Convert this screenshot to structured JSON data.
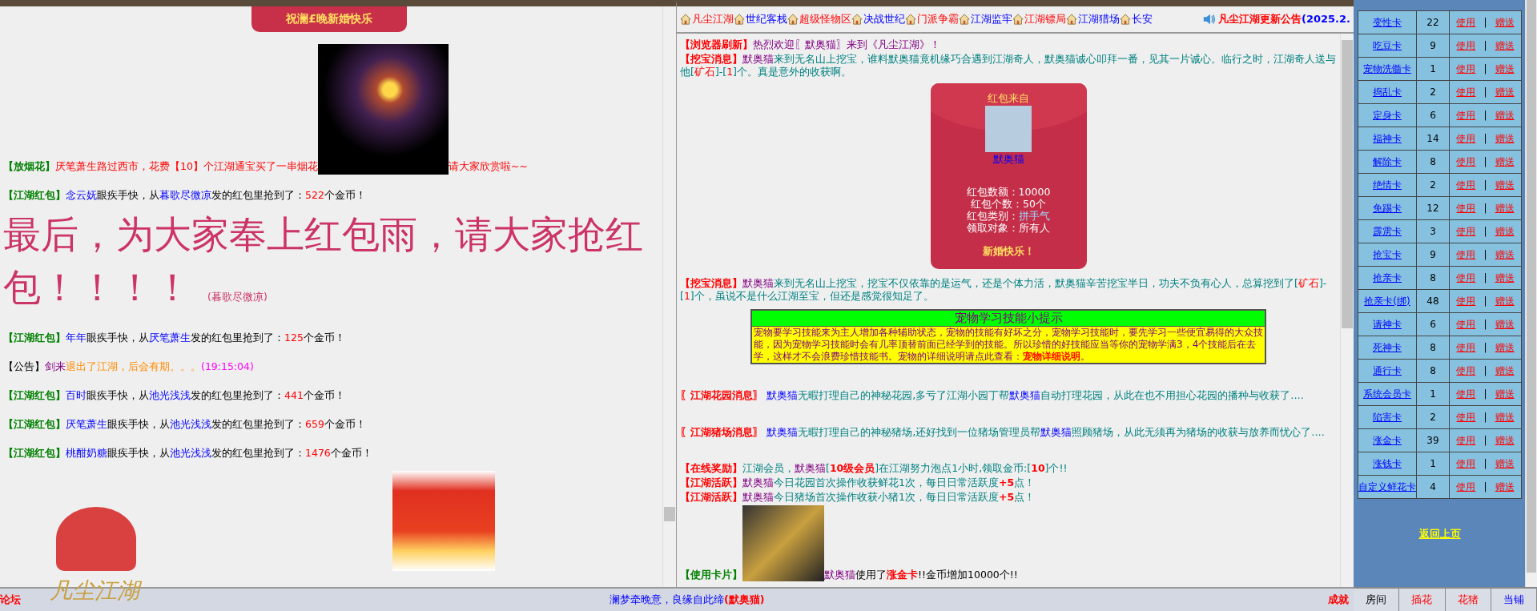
{
  "left_feed": [
    {
      "kind": "banner",
      "text": "祝澜£晚新婚快乐"
    },
    {
      "kind": "chat",
      "parts": [
        {
          "t": "【放烟花】",
          "kind": "label"
        },
        {
          "t": "厌笔萧生路过西市，花费【10】个江湖通宝买了一串烟花",
          "kind": "event"
        },
        {
          "kind": "image"
        },
        {
          "t": "请大家欣赏啦~~",
          "kind": "event"
        }
      ]
    },
    {
      "kind": "chat",
      "parts": [
        {
          "t": "【江湖红包】",
          "kind": "label"
        },
        {
          "t": "念云妩",
          "kind": "name"
        },
        {
          "t": "眼疾手快，从",
          "kind": "text"
        },
        {
          "t": "暮歌尽微凉",
          "kind": "name"
        },
        {
          "t": "发的红包里抢到了：",
          "kind": "text"
        },
        {
          "t": "522",
          "kind": "amount"
        },
        {
          "t": "个金币！",
          "kind": "text"
        }
      ]
    },
    {
      "kind": "headline",
      "text": "最后，为大家奉上红包雨，请大家抢红包！！！！",
      "signature": "(暮歌尽微凉)"
    },
    {
      "kind": "chat",
      "parts": [
        {
          "t": "【江湖红包】",
          "kind": "label"
        },
        {
          "t": "年年",
          "kind": "name"
        },
        {
          "t": "眼疾手快，从",
          "kind": "text"
        },
        {
          "t": "厌笔萧生",
          "kind": "name"
        },
        {
          "t": "发的红包里抢到了：",
          "kind": "text"
        },
        {
          "t": "125",
          "kind": "amount"
        },
        {
          "t": "个金币！",
          "kind": "text"
        }
      ]
    },
    {
      "kind": "chat",
      "parts": [
        {
          "t": "【公告】",
          "kind": "text"
        },
        {
          "t": "剑来",
          "kind": "player"
        },
        {
          "t": "退出了江湖，后会有期。。。",
          "kind": "farewell"
        },
        {
          "t": "(19:15:04)",
          "kind": "time"
        }
      ]
    },
    {
      "kind": "chat",
      "parts": [
        {
          "t": "【江湖红包】",
          "kind": "label"
        },
        {
          "t": "百时",
          "kind": "name"
        },
        {
          "t": "眼疾手快，从",
          "kind": "text"
        },
        {
          "t": "池光浅浅",
          "kind": "name"
        },
        {
          "t": "发的红包里抢到了：",
          "kind": "text"
        },
        {
          "t": "441",
          "kind": "amount"
        },
        {
          "t": "个金币！",
          "kind": "text"
        }
      ]
    },
    {
      "kind": "chat",
      "parts": [
        {
          "t": "【江湖红包】",
          "kind": "label"
        },
        {
          "t": "厌笔萧生",
          "kind": "name"
        },
        {
          "t": "眼疾手快，从",
          "kind": "text"
        },
        {
          "t": "池光浅浅",
          "kind": "name"
        },
        {
          "t": "发的红包里抢到了：",
          "kind": "text"
        },
        {
          "t": "659",
          "kind": "amount"
        },
        {
          "t": "个金币！",
          "kind": "text"
        }
      ]
    },
    {
      "kind": "chat",
      "parts": [
        {
          "t": "【江湖红包】",
          "kind": "label"
        },
        {
          "t": "桃酣奶糖",
          "kind": "name"
        },
        {
          "t": "眼疾手快，从",
          "kind": "text"
        },
        {
          "t": "池光浅浅",
          "kind": "name"
        },
        {
          "t": "发的红包里抢到了：",
          "kind": "text"
        },
        {
          "t": "1476",
          "kind": "amount"
        },
        {
          "t": "个金币！",
          "kind": "text"
        }
      ]
    },
    {
      "kind": "pictures"
    }
  ],
  "nav": {
    "links": [
      {
        "label": "凡尘江湖",
        "kind": "featured"
      },
      {
        "label": "世纪客栈",
        "kind": "regular"
      },
      {
        "label": "超级怪物区",
        "kind": "featured"
      },
      {
        "label": "决战世纪",
        "kind": "regular"
      },
      {
        "label": "门派争霸",
        "kind": "featured"
      },
      {
        "label": "江湖监牢",
        "kind": "regular"
      },
      {
        "label": "江湖镖局",
        "kind": "featured"
      },
      {
        "label": "江湖猎场",
        "kind": "regular"
      },
      {
        "label": "长安",
        "kind": "regular"
      }
    ],
    "notice": {
      "title": "凡尘江湖更新公告",
      "date": "(2025.2."
    }
  },
  "middle_feed": [
    {
      "kind": "chat",
      "parts": [
        {
          "t": "【浏览器刷新】",
          "kind": "alert"
        },
        {
          "t": "热烈欢迎〖默奥猫〗来到《凡尘江湖》！",
          "kind": "player"
        }
      ]
    },
    {
      "kind": "chat",
      "parts": [
        {
          "t": "【挖宝消息】",
          "kind": "alert"
        },
        {
          "t": "默奥猫",
          "kind": "player"
        },
        {
          "t": "来到无名山上挖宝，谁料默奥猫竟机缘巧合遇到江湖奇人，默奥猫诚心叩拜一番，见其一片诚心。临行之时，江湖奇人送与他[",
          "kind": "story"
        },
        {
          "t": "矿石",
          "kind": "amount"
        },
        {
          "t": "]-[",
          "kind": "story"
        },
        {
          "t": "1",
          "kind": "amount"
        },
        {
          "t": "]个。真是意外的收获啊。",
          "kind": "story"
        }
      ]
    },
    {
      "kind": "envelope",
      "from_label": "红包来自",
      "sender": "默奥猫",
      "details": [
        {
          "label": "红包数额：",
          "value": "10000",
          "kind": "plain"
        },
        {
          "label": "红包个数：",
          "value": "50个",
          "kind": "plain"
        },
        {
          "label": "红包类别：",
          "value": "拼手气",
          "kind": "accent"
        },
        {
          "label": "领取对象：",
          "value": "所有人",
          "kind": "plain"
        }
      ],
      "greeting": "新婚快乐！"
    },
    {
      "kind": "chat",
      "parts": [
        {
          "t": "【挖宝消息】",
          "kind": "alert"
        },
        {
          "t": "默奥猫",
          "kind": "player"
        },
        {
          "t": "来到无名山上挖宝，挖宝不仅依靠的是运气，还是个体力活，默奥猫辛苦挖宝半日，功夫不负有心人，总算挖到了[",
          "kind": "story"
        },
        {
          "t": "矿石",
          "kind": "amount"
        },
        {
          "t": "]-[",
          "kind": "story"
        },
        {
          "t": "1",
          "kind": "amount"
        },
        {
          "t": "]个，虽说不是什么江湖至宝，但还是感觉很知足了。",
          "kind": "story"
        }
      ]
    },
    {
      "kind": "tip",
      "title": "宠物学习技能小提示",
      "text": "宠物要学习技能来为主人增加各种辅助状态，宠物的技能有好坏之分，宠物学习技能时，要先学习一些便宜易得的大众技能，因为宠物学习技能时会有几率顶替前面已经学到的技能。所以珍惜的好技能应当等你的宠物学满3，4个技能后在去学，这样才不会浪费珍惜技能书。宠物的详细说明请点此查看：",
      "link": "宠物详细说明",
      "end": "。"
    },
    {
      "kind": "notice",
      "parts": [
        {
          "t": "〖江湖花园消息〗",
          "kind": "alert"
        },
        {
          "t": " 默奥猫",
          "kind": "name"
        },
        {
          "t": "无暇打理自己的神秘花园,多亏了江湖小园丁帮",
          "kind": "story"
        },
        {
          "t": "默奥猫",
          "kind": "name"
        },
        {
          "t": "自动打理花园，从此在也不用担心花园的播种与收获了....",
          "kind": "story"
        }
      ]
    },
    {
      "kind": "notice",
      "parts": [
        {
          "t": "〖江湖猪场消息〗",
          "kind": "alert"
        },
        {
          "t": " 默奥猫",
          "kind": "name"
        },
        {
          "t": "无暇打理自己的神秘猪场,还好找到一位猪场管理员帮",
          "kind": "story"
        },
        {
          "t": "默奥猫",
          "kind": "name"
        },
        {
          "t": "照顾猪场，从此无须再为猪场的收获与放养而忧心了....",
          "kind": "story"
        }
      ]
    },
    {
      "kind": "chat",
      "parts": [
        {
          "t": "【在线奖励】",
          "kind": "alert"
        },
        {
          "t": "江湖会员，",
          "kind": "story"
        },
        {
          "t": "默奥猫",
          "kind": "player"
        },
        {
          "t": "[",
          "kind": "story"
        },
        {
          "t": "10级会员",
          "kind": "highlight"
        },
        {
          "t": "]在江湖努力泡点1小时,领取金币:[",
          "kind": "story"
        },
        {
          "t": "10",
          "kind": "highlight"
        },
        {
          "t": "]个!!",
          "kind": "story"
        }
      ]
    },
    {
      "kind": "chat",
      "parts": [
        {
          "t": "【江湖活跃】",
          "kind": "alert"
        },
        {
          "t": "默奥猫",
          "kind": "player"
        },
        {
          "t": "今日花园首次操作收获鲜花1次，每日日常活跃度",
          "kind": "story"
        },
        {
          "t": "+5",
          "kind": "highlight"
        },
        {
          "t": "点！",
          "kind": "story"
        }
      ]
    },
    {
      "kind": "chat",
      "parts": [
        {
          "t": "【江湖活跃】",
          "kind": "alert"
        },
        {
          "t": "默奥猫",
          "kind": "player"
        },
        {
          "t": "今日猪场首次操作收获小猪1次，每日日常活跃度",
          "kind": "story"
        },
        {
          "t": "+5",
          "kind": "highlight"
        },
        {
          "t": "点！",
          "kind": "story"
        }
      ]
    },
    {
      "kind": "chat",
      "parts": [
        {
          "t": "【使用卡片】",
          "kind": "label"
        },
        {
          "kind": "image"
        },
        {
          "t": "默奥猫",
          "kind": "player"
        },
        {
          "t": "使用了",
          "kind": "text"
        },
        {
          "t": "涨金卡",
          "kind": "highlight"
        },
        {
          "t": "!!金币增加10000个!!",
          "kind": "text"
        }
      ]
    }
  ],
  "bottom_bar": {
    "forum": "论坛",
    "logo": "凡尘江湖",
    "message": "澜梦牵晚意，良缘自此缔",
    "name": "(默奥猫)",
    "achievements": "成就"
  },
  "cards": {
    "rows": [
      {
        "name": "变性卡",
        "count": "22",
        "use": "使用",
        "sep": "|",
        "gift": "赠送"
      },
      {
        "name": "吃豆卡",
        "count": "9",
        "use": "使用",
        "sep": "|",
        "gift": "赠送"
      },
      {
        "name": "宠物洗髓卡",
        "count": "1",
        "use": "使用",
        "sep": "|",
        "gift": "赠送"
      },
      {
        "name": "捣乱卡",
        "count": "2",
        "use": "使用",
        "sep": "|",
        "gift": "赠送"
      },
      {
        "name": "定身卡",
        "count": "6",
        "use": "使用",
        "sep": "|",
        "gift": "赠送"
      },
      {
        "name": "福神卡",
        "count": "14",
        "use": "使用",
        "sep": "|",
        "gift": "赠送"
      },
      {
        "name": "解除卡",
        "count": "8",
        "use": "使用",
        "sep": "|",
        "gift": "赠送"
      },
      {
        "name": "绝情卡",
        "count": "2",
        "use": "使用",
        "sep": "|",
        "gift": "赠送"
      },
      {
        "name": "免踢卡",
        "count": "12",
        "use": "使用",
        "sep": "|",
        "gift": "赠送"
      },
      {
        "name": "霹雳卡",
        "count": "3",
        "use": "使用",
        "sep": "|",
        "gift": "赠送"
      },
      {
        "name": "抢宝卡",
        "count": "9",
        "use": "使用",
        "sep": "|",
        "gift": "赠送"
      },
      {
        "name": "抢亲卡",
        "count": "8",
        "use": "使用",
        "sep": "|",
        "gift": "赠送"
      },
      {
        "name": "抢亲卡(绑)",
        "count": "48",
        "use": "使用",
        "sep": "|",
        "gift": "赠送"
      },
      {
        "name": "请神卡",
        "count": "6",
        "use": "使用",
        "sep": "|",
        "gift": "赠送"
      },
      {
        "name": "死神卡",
        "count": "8",
        "use": "使用",
        "sep": "|",
        "gift": "赠送"
      },
      {
        "name": "通行卡",
        "count": "8",
        "use": "使用",
        "sep": "|",
        "gift": "赠送"
      },
      {
        "name": "系统会员卡",
        "count": "1",
        "use": "使用",
        "sep": "|",
        "gift": "赠送"
      },
      {
        "name": "陷害卡",
        "count": "2",
        "use": "使用",
        "sep": "|",
        "gift": "赠送"
      },
      {
        "name": "涨金卡",
        "count": "39",
        "use": "使用",
        "sep": "|",
        "gift": "赠送"
      },
      {
        "name": "涨钱卡",
        "count": "1",
        "use": "使用",
        "sep": "|",
        "gift": "赠送"
      },
      {
        "name": "自定义鲜花卡",
        "count": "4",
        "use": "使用",
        "sep": "|",
        "gift": "赠送"
      }
    ],
    "back": "返回上页"
  },
  "tabs": [
    {
      "label": "房间",
      "kind": "room"
    },
    {
      "label": "插花",
      "kind": "garden"
    },
    {
      "label": "花猪",
      "kind": "garden"
    },
    {
      "label": "当铺",
      "kind": "shop"
    }
  ]
}
